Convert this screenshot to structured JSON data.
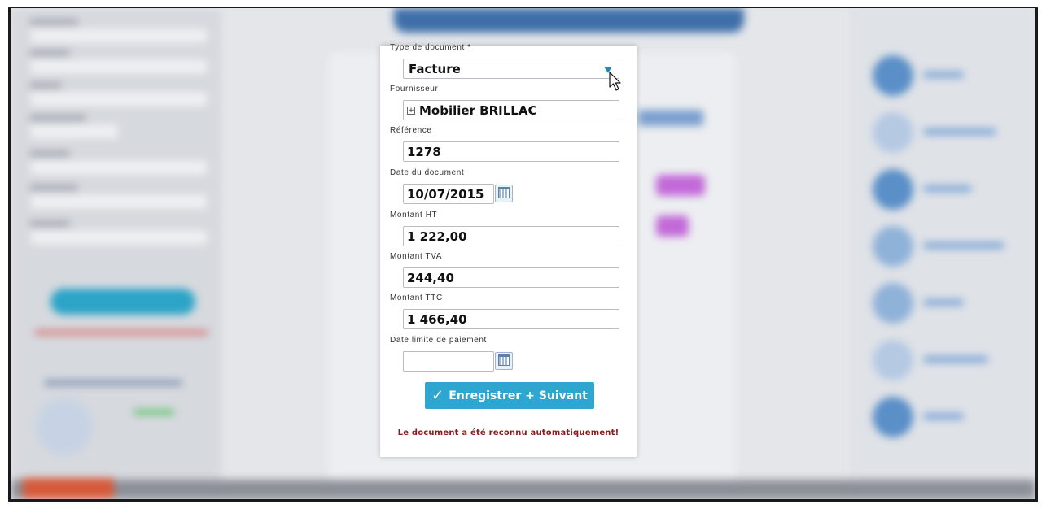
{
  "form": {
    "type_label": "Type de document *",
    "type_value": "Facture",
    "supplier_label": "Fournisseur",
    "supplier_value": "Mobilier BRILLAC",
    "reference_label": "Référence",
    "reference_value": "1278",
    "date_label": "Date du document",
    "date_value": "10/07/2015",
    "ht_label": "Montant HT",
    "ht_value": "1 222,00",
    "tva_label": "Montant TVA",
    "tva_value": "244,40",
    "ttc_label": "Montant TTC",
    "ttc_value": "1 466,40",
    "due_label": "Date limite de paiement",
    "due_value": ""
  },
  "actions": {
    "save_next_label": "Enregistrer + Suivant"
  },
  "status": {
    "message": "Le document a été reconnu automatiquement!"
  },
  "colors": {
    "accent": "#2fa6d0",
    "status_text": "#8b1a1a",
    "dropdown_arrow": "#1f8ac0"
  },
  "icons": {
    "dropdown": "chevron-down-icon",
    "calendar": "calendar-icon",
    "expand": "plus-box-icon",
    "check": "check-icon",
    "cursor": "mouse-pointer-icon"
  }
}
